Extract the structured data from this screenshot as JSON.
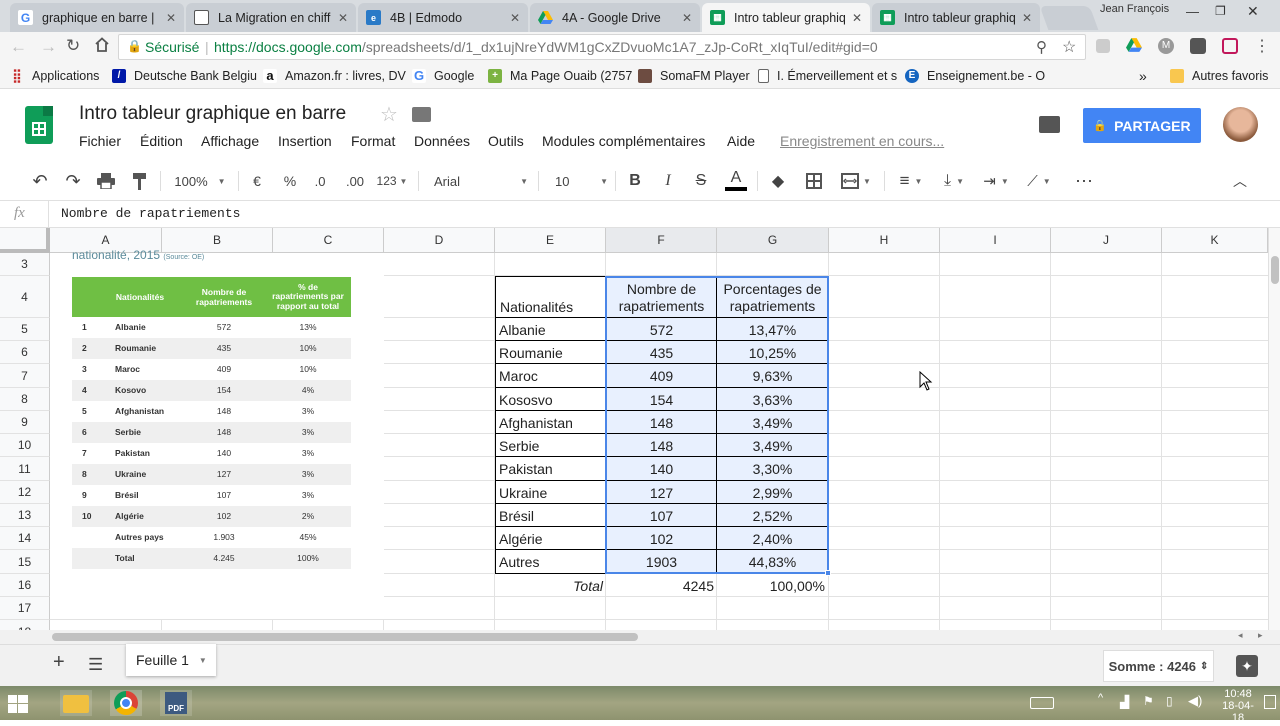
{
  "browser": {
    "tabs": [
      {
        "title": "graphique en barre |",
        "icon": "google-icon",
        "active": false
      },
      {
        "title": "La Migration en chiff",
        "icon": "document-icon",
        "active": false
      },
      {
        "title": "4B | Edmodo",
        "icon": "edmodo-icon",
        "active": false
      },
      {
        "title": "4A - Google Drive",
        "icon": "drive-icon",
        "active": false
      },
      {
        "title": "Intro tableur graphiq",
        "icon": "sheets-icon",
        "active": true
      },
      {
        "title": "Intro tableur graphiq",
        "icon": "sheets-icon",
        "active": false
      }
    ],
    "profile_name": "Jean François",
    "secure_label": "Sécurisé",
    "url_host": "https://docs.google.com",
    "url_path": "/spreadsheets/d/1_dx1ujNreYdWM1gCxZDvuoMc1A7_zJp-CoRt_xIqTuI/edit#gid=0",
    "bookmarks": [
      {
        "label": "Applications",
        "icon": "apps-grid-icon"
      },
      {
        "label": "Deutsche Bank Belgiu",
        "icon": "bank-icon"
      },
      {
        "label": "Amazon.fr : livres, DV",
        "icon": "amazon-icon"
      },
      {
        "label": "Google",
        "icon": "google-icon"
      },
      {
        "label": "Ma Page Ouaib (2757",
        "icon": "plus-icon"
      },
      {
        "label": "SomaFM Player",
        "icon": "radio-icon"
      },
      {
        "label": "I. Émerveillement et s",
        "icon": "document-icon"
      },
      {
        "label": "Enseignement.be - O",
        "icon": "e-icon"
      }
    ],
    "bookmarks_more": "»",
    "other_bookmarks": "Autres favoris"
  },
  "doc": {
    "title": "Intro tableur graphique en barre",
    "menu": [
      "Fichier",
      "Édition",
      "Affichage",
      "Insertion",
      "Format",
      "Données",
      "Outils",
      "Modules complémentaires",
      "Aide"
    ],
    "save_status": "Enregistrement en cours...",
    "share_label": "PARTAGER"
  },
  "toolbar": {
    "zoom": "100%",
    "currency": "€",
    "percent": "%",
    "dec_less": ".0",
    "dec_more": ".00",
    "format_more": "123",
    "font": "Arial",
    "font_size": "10"
  },
  "formula_bar": {
    "fx": "fx",
    "content": "Nombre de rapatriements"
  },
  "grid": {
    "columns": [
      "A",
      "B",
      "C",
      "D",
      "E",
      "F",
      "G",
      "H",
      "I",
      "J",
      "K"
    ],
    "rows": [
      "3",
      "4",
      "5",
      "6",
      "7",
      "8",
      "9",
      "10",
      "11",
      "12",
      "13",
      "14",
      "15",
      "16",
      "17",
      "18"
    ],
    "table": {
      "header": [
        "Nationalités",
        "Nombre de rapatriements",
        "Porcentages de rapatriements"
      ],
      "header_lines": {
        "col_f": [
          "Nombre de",
          "rapatriements"
        ],
        "col_g": [
          "Porcentages de",
          "rapatriements"
        ]
      },
      "rows": [
        [
          "Albanie",
          "572",
          "13,47%"
        ],
        [
          "Roumanie",
          "435",
          "10,25%"
        ],
        [
          "Maroc",
          "409",
          "9,63%"
        ],
        [
          "Kososvo",
          "154",
          "3,63%"
        ],
        [
          "Afghanistan",
          "148",
          "3,49%"
        ],
        [
          "Serbie",
          "148",
          "3,49%"
        ],
        [
          "Pakistan",
          "140",
          "3,30%"
        ],
        [
          "Ukraine",
          "127",
          "2,99%"
        ],
        [
          "Brésil",
          "107",
          "2,52%"
        ],
        [
          "Algérie",
          "102",
          "2,40%"
        ],
        [
          "Autres",
          "1903",
          "44,83%"
        ]
      ],
      "total": [
        "Total",
        "4245",
        "100,00%"
      ]
    },
    "source_image": {
      "caption": "nationalité, 2015",
      "caption_source": "(Source: OE)",
      "headers": [
        "Nationalités",
        "Nombre de rapatriements",
        "% de rapatriements par rapport au total"
      ],
      "header_lines": {
        "col2": [
          "Nombre de",
          "rapatriements"
        ],
        "col3": [
          "% de",
          "rapatriements par",
          "rapport au total"
        ]
      },
      "rows": [
        [
          "1",
          "Albanie",
          "572",
          "13%"
        ],
        [
          "2",
          "Roumanie",
          "435",
          "10%"
        ],
        [
          "3",
          "Maroc",
          "409",
          "10%"
        ],
        [
          "4",
          "Kosovo",
          "154",
          "4%"
        ],
        [
          "5",
          "Afghanistan",
          "148",
          "3%"
        ],
        [
          "6",
          "Serbie",
          "148",
          "3%"
        ],
        [
          "7",
          "Pakistan",
          "140",
          "3%"
        ],
        [
          "8",
          "Ukraine",
          "127",
          "3%"
        ],
        [
          "9",
          "Brésil",
          "107",
          "3%"
        ],
        [
          "10",
          "Algérie",
          "102",
          "2%"
        ],
        [
          "",
          "Autres pays",
          "1.903",
          "45%"
        ],
        [
          "",
          "Total",
          "4.245",
          "100%"
        ]
      ],
      "header_color": "#6fbf44"
    }
  },
  "sheets": {
    "tabs": [
      {
        "label": "Feuille 1"
      }
    ],
    "sum_label": "Somme : 4246"
  },
  "taskbar": {
    "time": "10:48",
    "date": "18-04-18",
    "pdf_label": "PDF"
  },
  "colors": {
    "accent_blue": "#4285f4",
    "sheets_green": "#0f9d58",
    "selection_fill": "#e8f0fe",
    "selection_border": "#4a86e8"
  }
}
